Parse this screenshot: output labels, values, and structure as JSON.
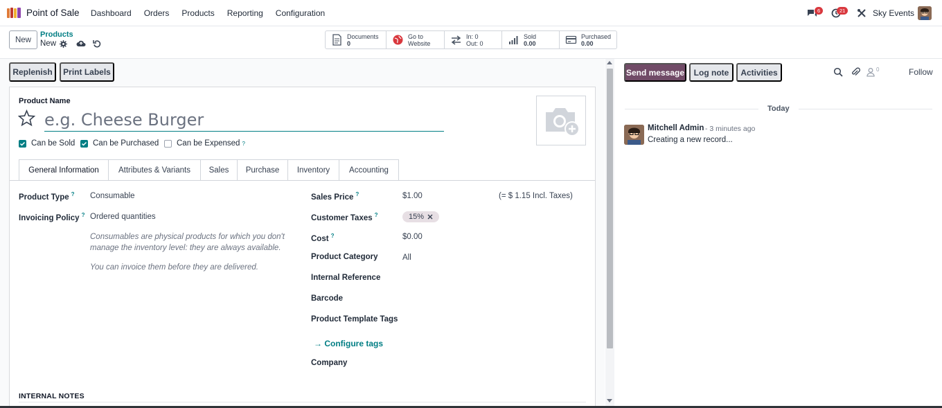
{
  "topbar": {
    "app_name": "Point of Sale",
    "menu": [
      "Dashboard",
      "Orders",
      "Products",
      "Reporting",
      "Configuration"
    ],
    "chat_count": "6",
    "activity_count": "21",
    "company": "Sky Events"
  },
  "control": {
    "new_label": "New",
    "breadcrumb_parent": "Products",
    "breadcrumb_current": "New"
  },
  "smart_buttons": {
    "documents_label": "Documents",
    "documents_value": "0",
    "website_line1": "Go to",
    "website_line2": "Website",
    "in_label": "In: 0",
    "out_label": "Out: 0",
    "sold_label": "Sold",
    "sold_value": "0.00",
    "purchased_label": "Purchased",
    "purchased_value": "0.00"
  },
  "actions": {
    "replenish": "Replenish",
    "print_labels": "Print Labels"
  },
  "form": {
    "product_name_label": "Product Name",
    "product_name_placeholder": "e.g. Cheese Burger",
    "checkboxes": [
      {
        "label": "Can be Sold",
        "checked": true
      },
      {
        "label": "Can be Purchased",
        "checked": true
      },
      {
        "label": "Can be Expensed",
        "checked": false
      }
    ],
    "help_mark": "?",
    "tabs": [
      "General Information",
      "Attributes & Variants",
      "Sales",
      "Purchase",
      "Inventory",
      "Accounting"
    ],
    "product_type_label": "Product Type",
    "product_type_value": "Consumable",
    "invoicing_policy_label": "Invoicing Policy",
    "invoicing_policy_value": "Ordered quantities",
    "help_text_1": "Consumables are physical products for which you don't manage the inventory level: they are always available.",
    "help_text_2": "You can invoice them before they are delivered.",
    "sales_price_label": "Sales Price",
    "sales_price_value": "$1.00",
    "incl_taxes": "(= $ 1.15 Incl. Taxes)",
    "customer_taxes_label": "Customer Taxes",
    "customer_taxes_tag": "15%",
    "cost_label": "Cost",
    "cost_value": "$0.00",
    "product_category_label": "Product Category",
    "product_category_value": "All",
    "internal_reference_label": "Internal Reference",
    "barcode_label": "Barcode",
    "template_tags_label": "Product Template Tags",
    "configure_tags": "Configure tags",
    "company_label": "Company",
    "internal_notes": "INTERNAL NOTES"
  },
  "chatter": {
    "send_message": "Send message",
    "log_note": "Log note",
    "activities": "Activities",
    "followers_count": "0",
    "follow": "Follow",
    "today": "Today",
    "author": "Mitchell Admin",
    "time": "- 3 minutes ago",
    "body": "Creating a new record..."
  },
  "colors": {
    "brand": "#714b67",
    "accent": "#017e84",
    "badge": "#d9383e"
  }
}
